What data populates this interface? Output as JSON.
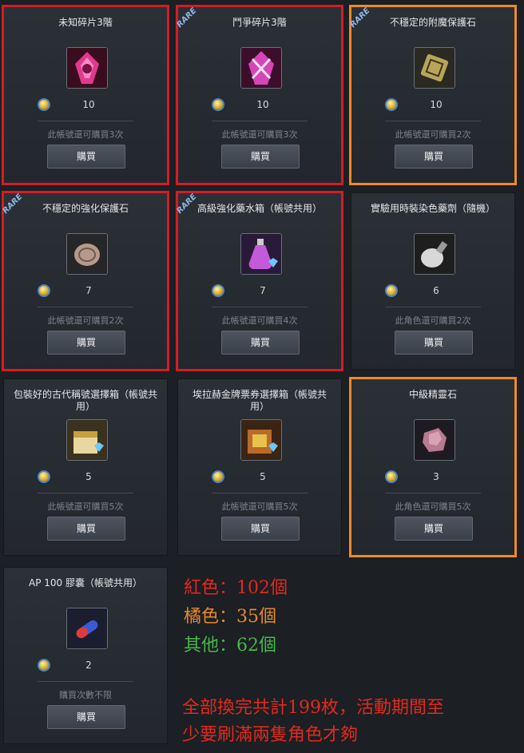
{
  "cards": [
    {
      "title": "未知碎片3階",
      "price": "10",
      "limit": "此帳號還可購買3次",
      "buy": "購買",
      "rare": false,
      "icon": "crystal-shard-icon"
    },
    {
      "title": "鬥爭碎片3階",
      "price": "10",
      "limit": "此帳號還可購買3次",
      "buy": "購買",
      "rare": true,
      "rare_label": "RARE",
      "icon": "swords-shard-icon"
    },
    {
      "title": "不穩定的附魔保護石",
      "price": "10",
      "limit": "此帳號還可購買2次",
      "buy": "購買",
      "rare": true,
      "rare_label": "RARE",
      "icon": "enchant-stone-icon"
    },
    {
      "title": "不穩定的強化保護石",
      "price": "7",
      "limit": "此帳號還可購買2次",
      "buy": "購買",
      "rare": true,
      "rare_label": "RARE",
      "icon": "reinforce-stone-icon"
    },
    {
      "title": "高級強化藥水箱（帳號共用）",
      "price": "7",
      "limit": "此帳號還可購買4次",
      "buy": "購買",
      "rare": true,
      "rare_label": "RARE",
      "icon": "potion-box-icon"
    },
    {
      "title": "實驗用時裝染色藥劑（隨機）",
      "price": "6",
      "limit": "此角色還可購買2次",
      "buy": "購買",
      "rare": false,
      "icon": "dye-bottle-icon"
    },
    {
      "title": "包裝好的古代稱號選擇箱（帳號共用）",
      "price": "5",
      "limit": "此帳號還可購買5次",
      "buy": "購買",
      "rare": false,
      "icon": "title-box-icon"
    },
    {
      "title": "埃拉赫金牌票券選擇箱（帳號共用）",
      "price": "5",
      "limit": "此帳號還可購買5次",
      "buy": "購買",
      "rare": false,
      "icon": "ticket-box-icon"
    },
    {
      "title": "中級精靈石",
      "price": "3",
      "limit": "此角色還可購買5次",
      "buy": "購買",
      "rare": false,
      "icon": "spirit-stone-icon"
    },
    {
      "title": "AP 100 膠囊（帳號共用）",
      "price": "2",
      "limit": "購買次數不限",
      "buy": "購買",
      "rare": false,
      "icon": "capsule-icon"
    }
  ],
  "notes": {
    "red": "紅色：102個",
    "orange": "橘色：35個",
    "other": "其他：62個",
    "summary_line1": "全部換完共計199枚，活動期間至",
    "summary_line2": "少要刷滿兩隻角色才夠"
  },
  "colors": {
    "red": "#e02a1d",
    "orange": "#e8892c",
    "green": "#46b84a",
    "panel": "#2b3037"
  }
}
